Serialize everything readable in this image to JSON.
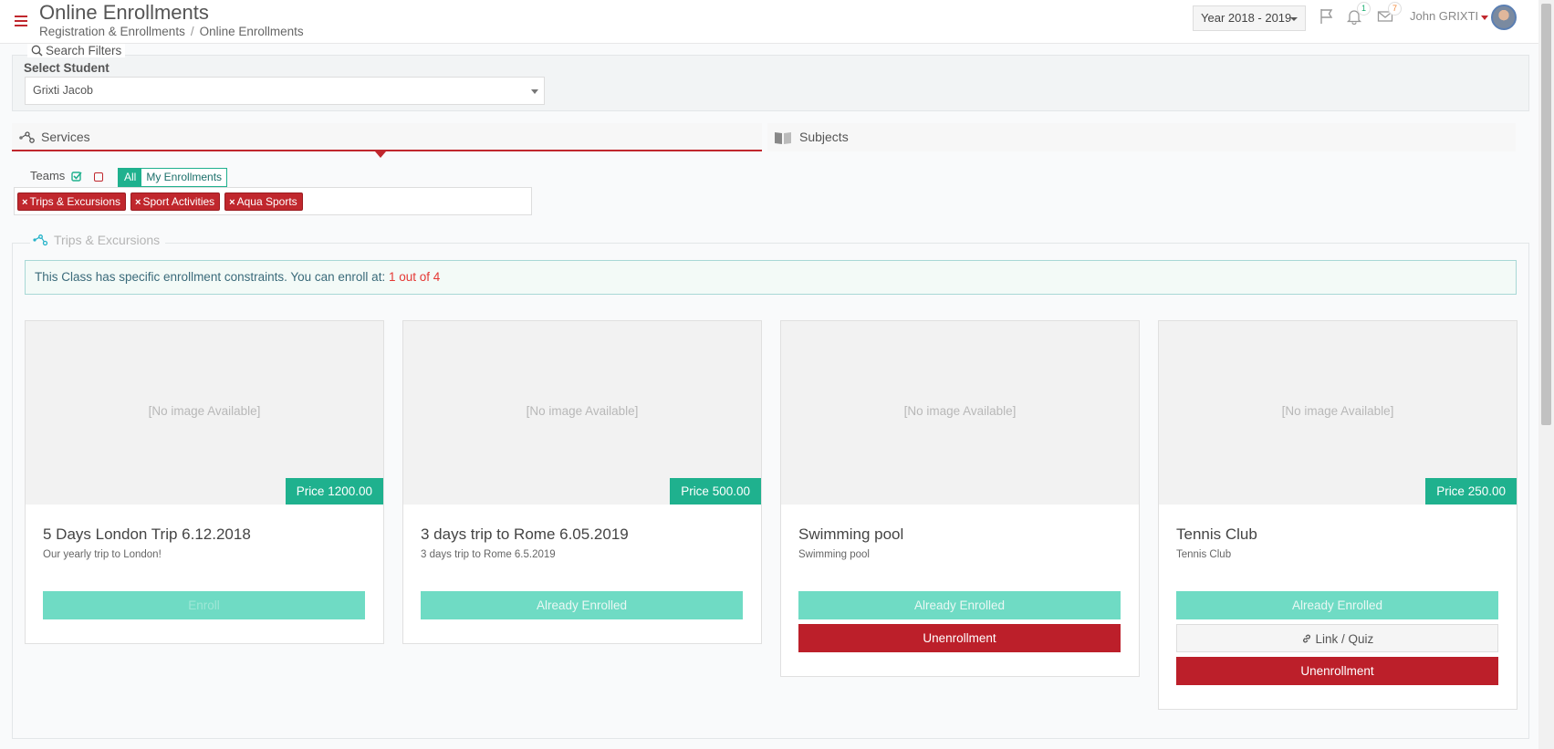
{
  "header": {
    "title": "Online Enrollments",
    "breadcrumb": [
      "Registration & Enrollments",
      "Online Enrollments"
    ],
    "year": "Year 2018 - 2019",
    "notifications_count": "1",
    "messages_count": "7",
    "user_name": "John GRIXTI"
  },
  "filters": {
    "legend": "Search Filters",
    "student_label": "Select Student",
    "student_value": "Grixti Jacob"
  },
  "tabs": [
    {
      "label": "Services",
      "active": true
    },
    {
      "label": "Subjects",
      "active": false
    }
  ],
  "teams": {
    "label": "Teams",
    "all_label": "All",
    "my_label": "My Enrollments",
    "tags": [
      "Trips & Excursions",
      "Sport Activities",
      "Aqua Sports"
    ]
  },
  "section": {
    "title": "Trips & Excursions",
    "alert_text": "This Class has specific enrollment constraints. You can enroll at: ",
    "alert_highlight": "1 out of 4"
  },
  "cards": [
    {
      "image_text": "[No image Available]",
      "price": "Price 1200.00",
      "title": "5 Days London Trip 6.12.2018",
      "description": "Our yearly trip to London!",
      "enroll_label": "Enroll"
    },
    {
      "image_text": "[No image Available]",
      "price": "Price 500.00",
      "title": "3 days trip to Rome 6.05.2019",
      "description": "3 days trip to Rome 6.5.2019",
      "enroll_label": "Already Enrolled"
    },
    {
      "image_text": "[No image Available]",
      "title": "Swimming pool",
      "description": "Swimming pool",
      "enroll_label": "Already Enrolled",
      "unenroll_label": "Unenrollment"
    },
    {
      "image_text": "[No image Available]",
      "price": "Price 250.00",
      "title": "Tennis Club",
      "description": "Tennis Club",
      "enroll_label": "Already Enrolled",
      "link_label": "Link / Quiz",
      "unenroll_label": "Unenrollment"
    }
  ],
  "colors": {
    "brand_red": "#c0272d",
    "accent_green": "#1fb18e",
    "light_green": "#6fdbc4"
  }
}
